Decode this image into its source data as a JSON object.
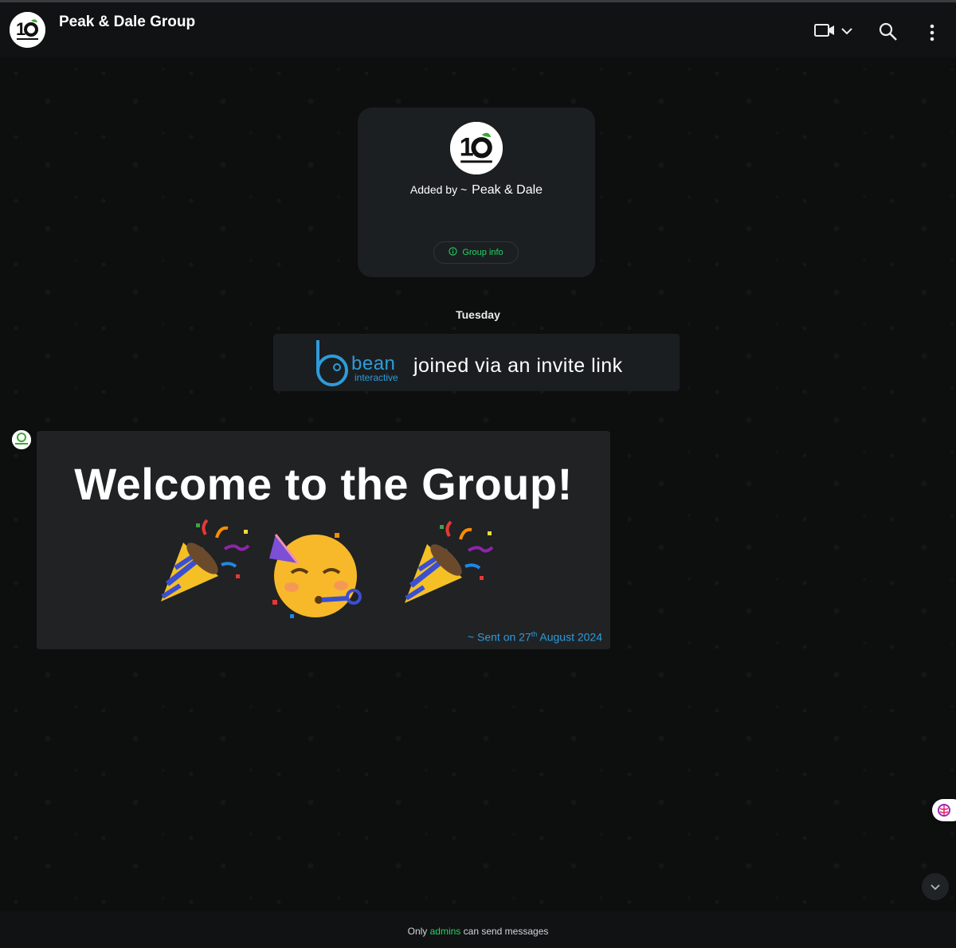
{
  "header": {
    "title": "Peak & Dale Group",
    "avatar_icon": "group-logo-icon",
    "actions": [
      "video-call-icon",
      "chevron-down-icon",
      "search-icon",
      "more-vert-icon"
    ]
  },
  "intro_card": {
    "added_by_prefix": "Added by ~",
    "added_by_name": "Peak & Dale",
    "group_info_label": "Group info"
  },
  "day_label": "Tuesday",
  "system_message": {
    "brand_word": "bean",
    "brand_sub": "interactive",
    "text": "joined via an invite link"
  },
  "welcome_message": {
    "title": "Welcome to the Group!",
    "emojis": [
      "party-popper",
      "partying-face",
      "party-popper"
    ],
    "sent_prefix": "~ Sent on 27",
    "sent_sup": "th",
    "sent_suffix": " August 2024"
  },
  "footer": {
    "prefix": "Only ",
    "admins": "admins",
    "suffix": " can send messages"
  },
  "colors": {
    "accent_green": "#25d366",
    "link_blue": "#2d9cdb",
    "header_bg": "#111213",
    "card_bg": "#1c1f21"
  }
}
